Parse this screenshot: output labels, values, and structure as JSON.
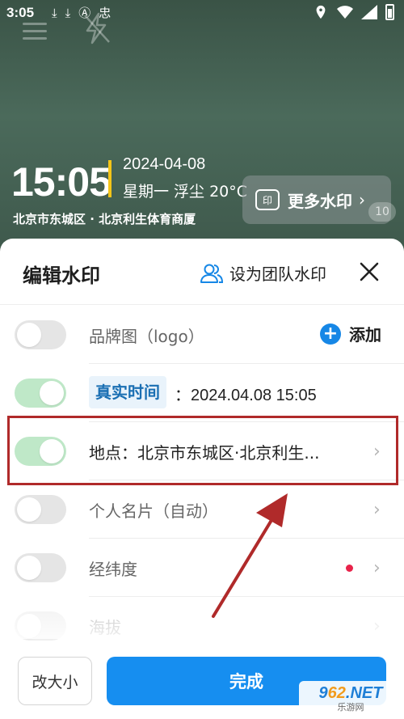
{
  "status_bar": {
    "time": "3:05",
    "misc_icon_text": "忠"
  },
  "preview": {
    "time": "15:05",
    "date": "2024-04-08",
    "weekday_weather": "星期一 浮尘 20°C",
    "address": "北京市东城区 · 北京利生体育商厦",
    "more_button_label": "更多水印",
    "more_button_badge": "印",
    "side_badge": "10"
  },
  "sheet": {
    "title": "编辑水印",
    "team_label": "设为团队水印",
    "rows": [
      {
        "label": "品牌图（logo）",
        "enabled": false,
        "action": "添加"
      },
      {
        "tag": "真实时间",
        "value": "2024.04.08 15:05",
        "enabled": true
      },
      {
        "label": "地点：北京市东城区·北京利生...",
        "enabled": true
      },
      {
        "label": "个人名片（自动）",
        "enabled": false
      },
      {
        "label": "经纬度",
        "enabled": false
      },
      {
        "label": "海拔",
        "enabled": false
      }
    ],
    "resize_label": "改大小",
    "done_label": "完成"
  },
  "site_logo": {
    "main_prefix": "9",
    "main_accent": "62",
    "main_suffix": ".NET",
    "sub": "乐游网"
  },
  "colors": {
    "accent_blue": "#168ef0",
    "toggle_on": "#bfe8c8",
    "highlight_red": "#b02a2a",
    "dot_red": "#e8234a",
    "preview_bar": "#f5c518"
  }
}
